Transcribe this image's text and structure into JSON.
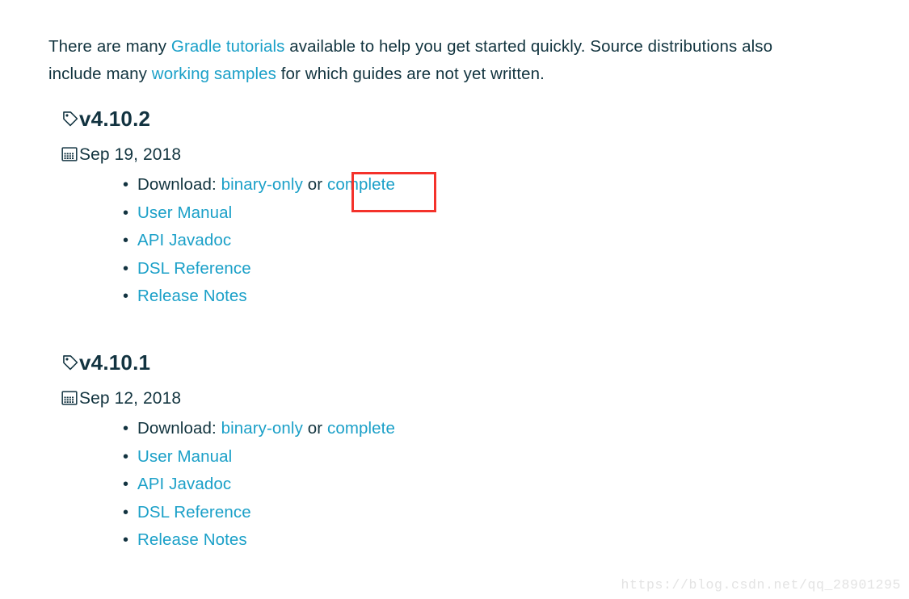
{
  "intro": {
    "segments": [
      {
        "type": "text",
        "text": "There are many "
      },
      {
        "type": "link",
        "text": "Gradle tutorials"
      },
      {
        "type": "text",
        "text": " available to help you get started quickly. Source distributions also include many "
      },
      {
        "type": "link",
        "text": "working samples"
      },
      {
        "type": "text",
        "text": " for which guides are not yet written."
      }
    ],
    "full_text": "There are many Gradle tutorials available to help you get started quickly. Source distributions also include many working samples for which guides are not yet written.",
    "link_1": "Gradle tutorials",
    "link_2": "working samples"
  },
  "colors": {
    "link": "#1ba0c8",
    "body_text": "#12343f",
    "heading": "#123340",
    "highlight_border": "#f4322b",
    "watermark": "#e3e3e3",
    "background": "#ffffff"
  },
  "icons": {
    "tag": "tag-icon",
    "calendar": "calendar-icon"
  },
  "releases": [
    {
      "version": "v4.10.2",
      "date": "Sep 19, 2018",
      "download": {
        "label": "Download:",
        "binary_link": "binary-only",
        "separator": "or",
        "complete_link": "complete"
      },
      "links": [
        "User Manual",
        "API Javadoc",
        "DSL Reference",
        "Release Notes"
      ]
    },
    {
      "version": "v4.10.1",
      "date": "Sep 12, 2018",
      "download": {
        "label": "Download:",
        "binary_link": "binary-only",
        "separator": "or",
        "complete_link": "complete"
      },
      "links": [
        "User Manual",
        "API Javadoc",
        "DSL Reference",
        "Release Notes"
      ]
    }
  ],
  "highlight": {
    "target": "complete",
    "color": "#f4322b"
  },
  "watermark": {
    "text": "https://blog.csdn.net/qq_28901295"
  }
}
